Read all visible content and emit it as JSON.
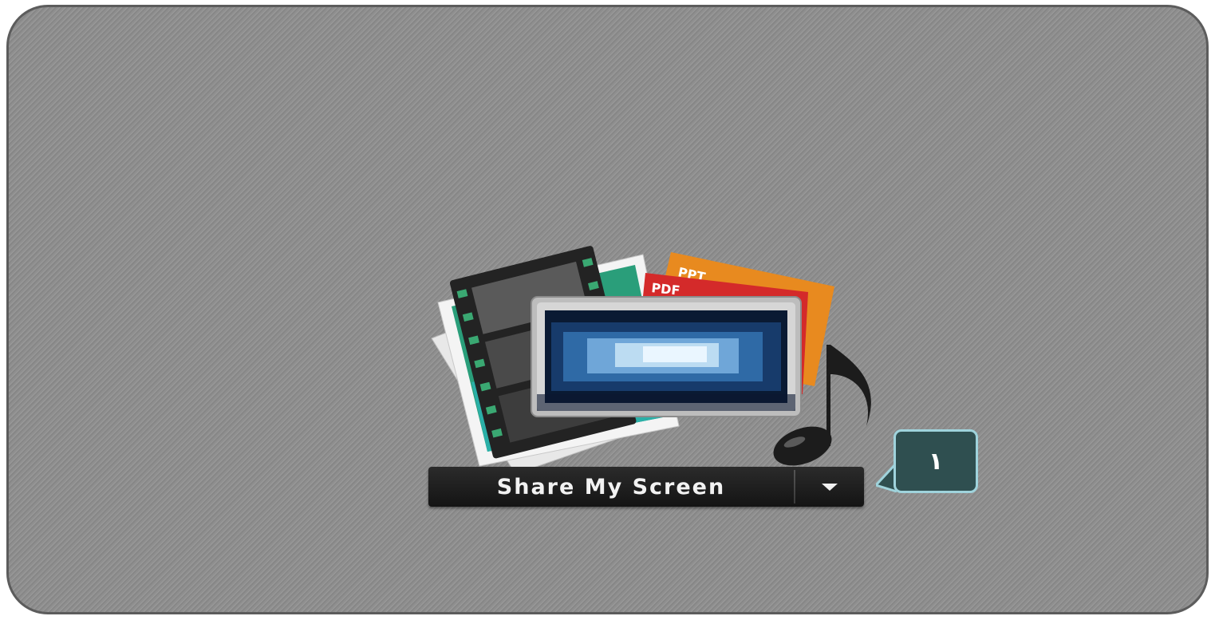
{
  "share_panel": {
    "button_label": "Share My Screen",
    "dropdown_icon": "chevron-down-icon"
  },
  "illustration": {
    "doc_labels": {
      "ppt": "PPT",
      "pdf": "PDF"
    },
    "icons": [
      "film-strip-icon",
      "photo-icon",
      "monitor-icon",
      "music-note-icon"
    ]
  },
  "callout": {
    "number": "١"
  },
  "colors": {
    "background": "#8f8f8f",
    "button": "#1e1e1e",
    "callout_fill": "#2f4f50",
    "callout_border": "#9fd3dc",
    "ppt": "#e88a1f",
    "pdf": "#d42a2a"
  }
}
